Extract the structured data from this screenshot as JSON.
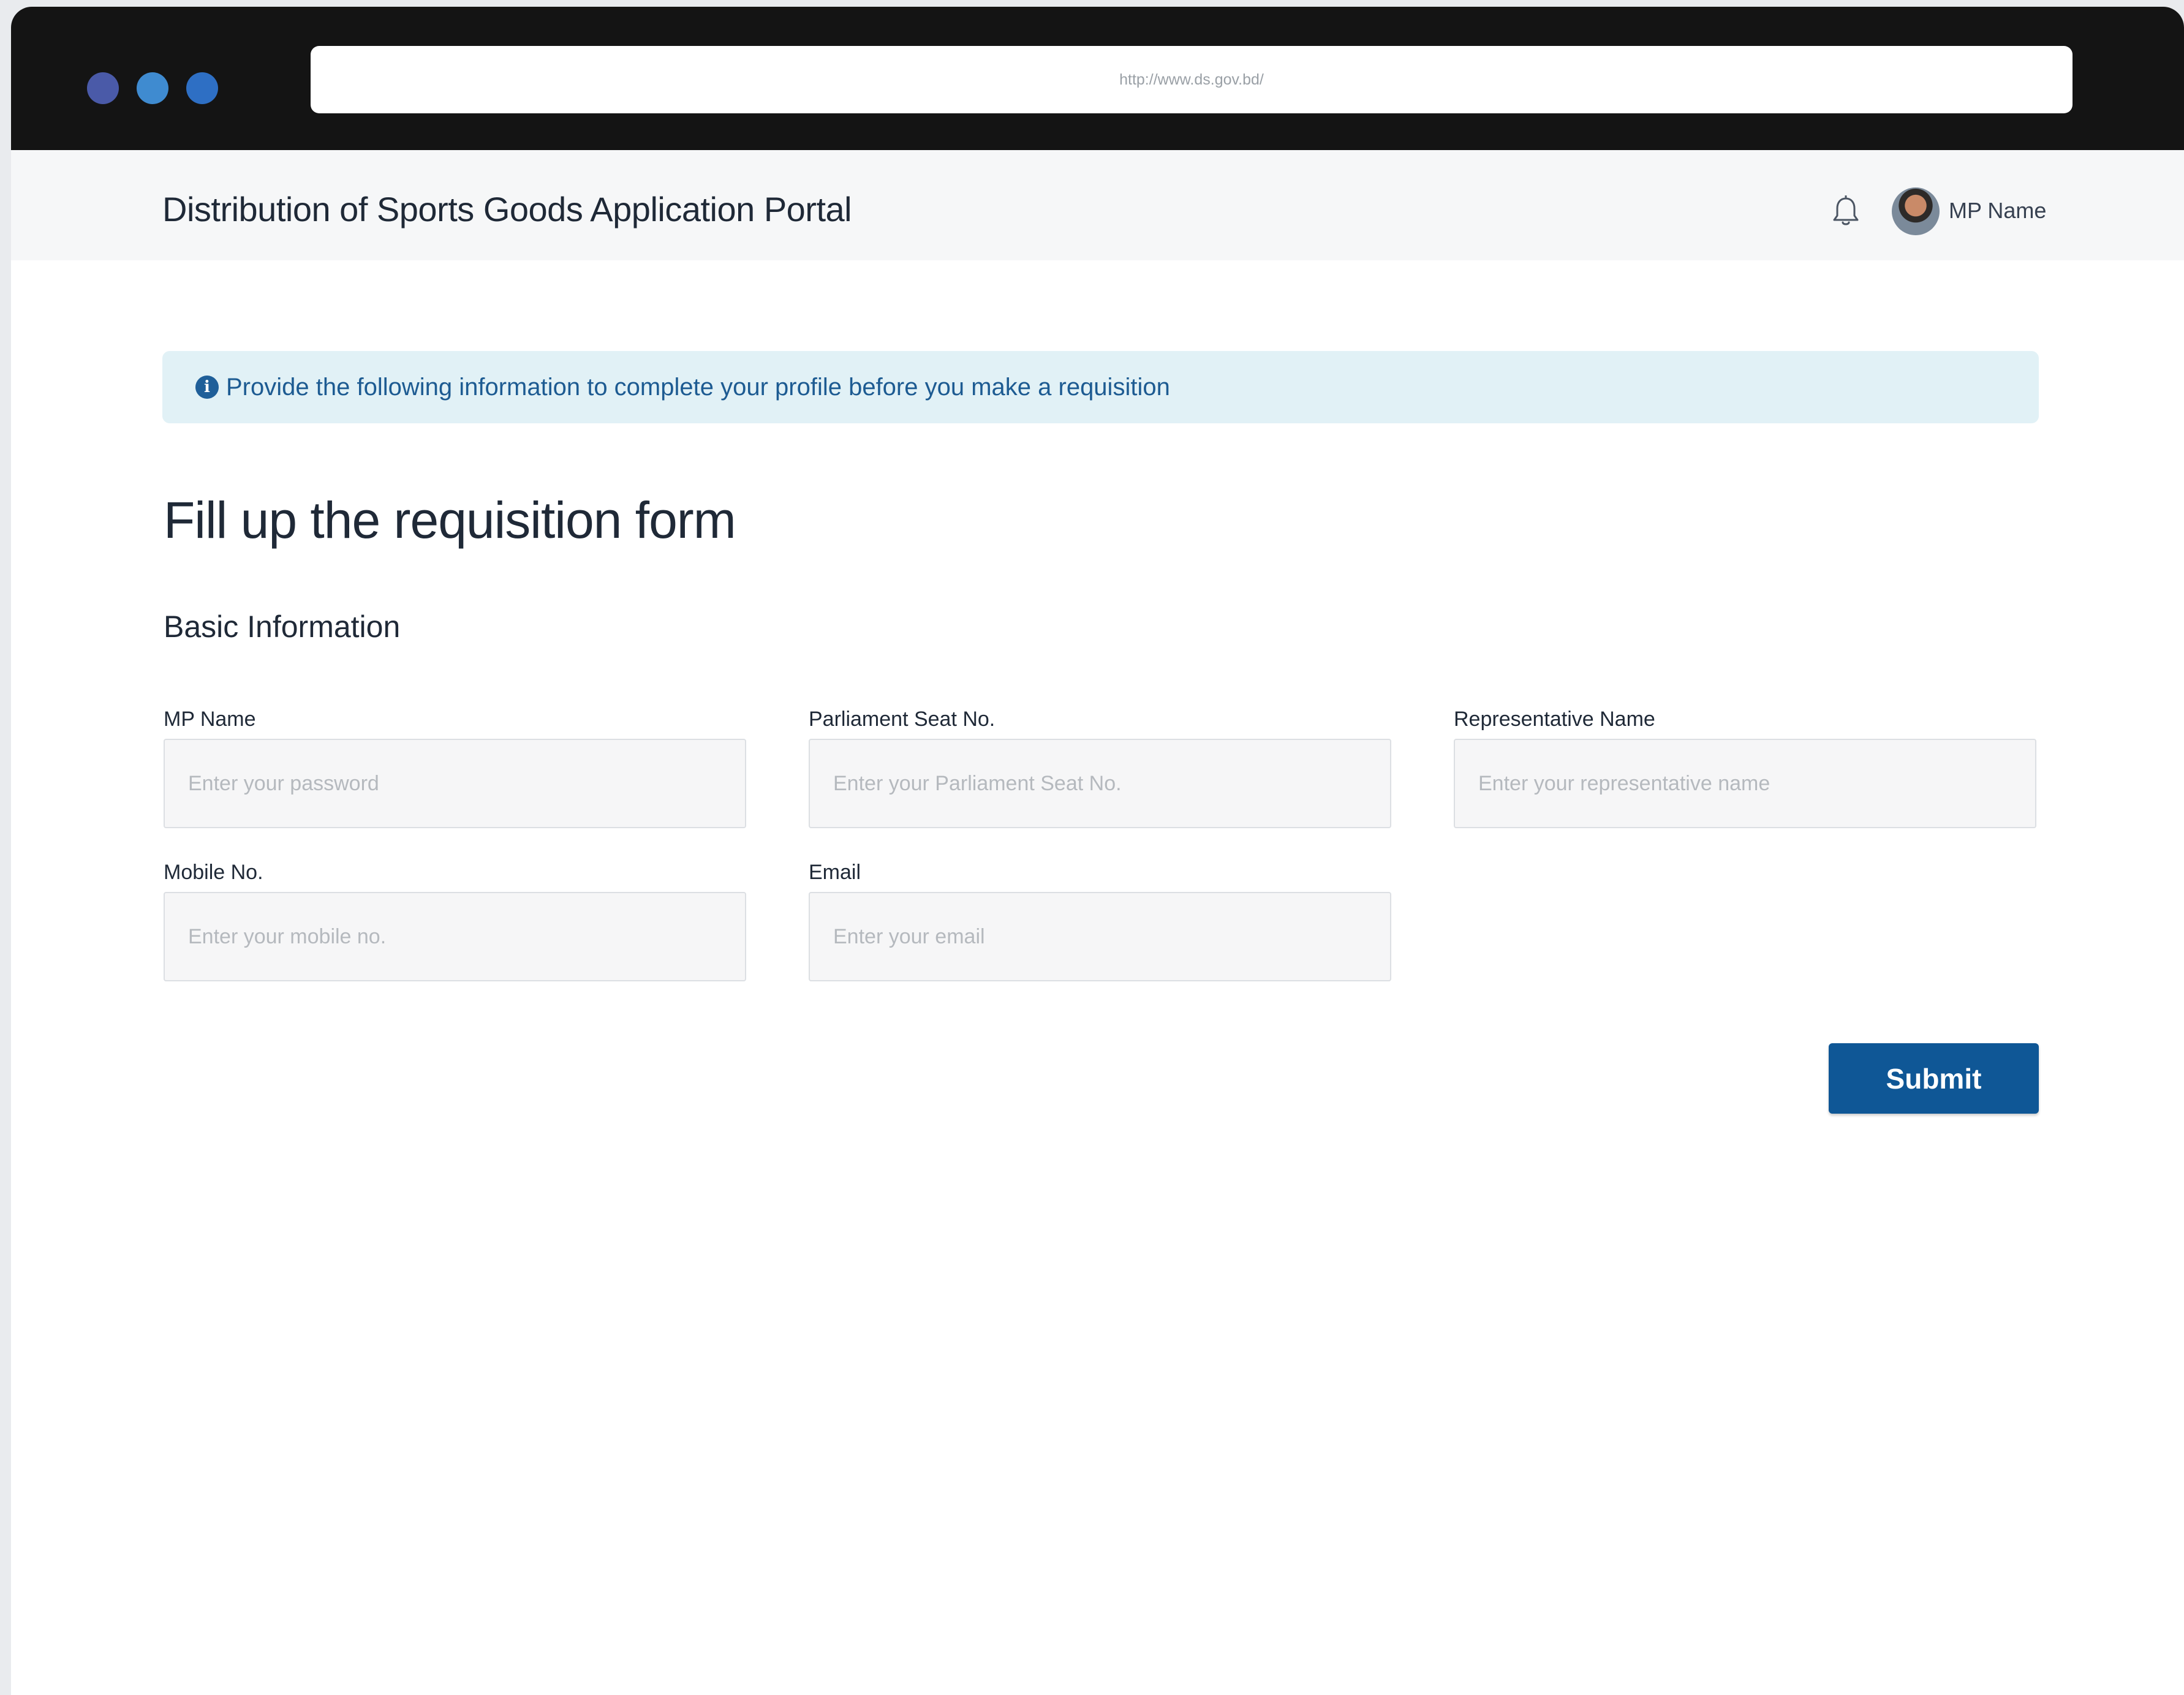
{
  "browser": {
    "url": "http://www.ds.gov.bd/"
  },
  "header": {
    "title": "Distribution of Sports Goods Application Portal",
    "user_name": "MP Name",
    "notification_icon": "bell-icon"
  },
  "alert": {
    "icon": "info-icon",
    "icon_glyph": "i",
    "text": "Provide the following information to complete your profile before you make a requisition"
  },
  "form": {
    "title": "Fill up the requisition form",
    "section": "Basic Information",
    "fields": [
      {
        "label": "MP Name",
        "placeholder": "Enter your password",
        "value": ""
      },
      {
        "label": "Parliament Seat No.",
        "placeholder": "Enter your Parliament Seat No.",
        "value": ""
      },
      {
        "label": "Representative Name",
        "placeholder": "Enter your representative name",
        "value": ""
      },
      {
        "label": "Mobile No.",
        "placeholder": "Enter your mobile no.",
        "value": ""
      },
      {
        "label": "Email",
        "placeholder": "Enter your email",
        "value": ""
      }
    ],
    "submit_label": "Submit"
  },
  "colors": {
    "primary": "#0f5796",
    "alert_bg": "#e1f1f6",
    "alert_text": "#1d5b92",
    "chrome_bg": "#141414"
  }
}
